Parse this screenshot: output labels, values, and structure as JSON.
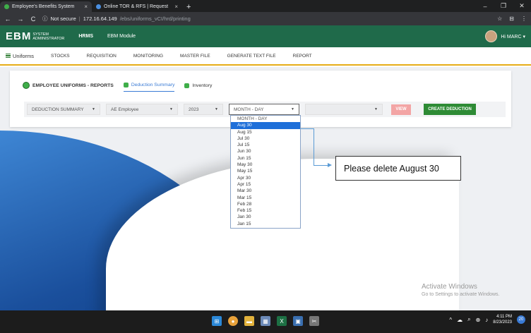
{
  "browser": {
    "tabs": [
      {
        "title": "Employee's Benefits System",
        "active": true,
        "close": "×"
      },
      {
        "title": "Online TOR & RFS | Request",
        "active": false,
        "close": "×"
      }
    ],
    "new_tab": "+",
    "window_controls": [
      "–",
      "❐",
      "✕"
    ],
    "nav": {
      "back": "←",
      "forward": "→",
      "reload": "C"
    },
    "security": "Not secure",
    "separator": "|",
    "url_host": "172.16.64.149",
    "url_path": "/ebs/uniforms_vCI/hrd/printing",
    "right_icons": [
      "☆",
      "⊟",
      "⋮"
    ]
  },
  "app": {
    "logo_big": "EBM",
    "logo_small_1": "SYSTEM",
    "logo_small_2": "ADMINISTRATOR",
    "header_links": [
      "HRMS",
      "EBM Module"
    ],
    "user_greeting": "Hi MARC ▾"
  },
  "nav": {
    "module": "Uniforms",
    "items": [
      "STOCKS",
      "REQUISITION",
      "MONITORING",
      "MASTER FILE",
      "GENERATE TEXT FILE",
      "REPORT"
    ]
  },
  "card": {
    "title": "EMPLOYEE UNIFORMS - REPORTS",
    "tabs": [
      "Deduction Summary",
      "Inventory"
    ],
    "filters": {
      "report_type": "DEDUCTION SUMMARY",
      "employee_type": "AE Employee",
      "year": "2023",
      "month_day": "MONTH - DAY",
      "extra": ""
    },
    "arrow": "▼",
    "view_label": "VIEW",
    "create_label": "CREATE DEDUCTION"
  },
  "dropdown": {
    "header": "MONTH - DAY",
    "selected": "Aug 30",
    "options": [
      "Aug 15",
      "Jul 30",
      "Jul 15",
      "Jun 30",
      "Jun 15",
      "May 30",
      "May 15",
      "Apr 30",
      "Apr 15",
      "Mar 30",
      "Mar 15",
      "Feb 28",
      "Feb 15",
      "Jan 30",
      "Jan 15"
    ]
  },
  "annotation": {
    "text": "Please delete August 30"
  },
  "watermark": {
    "line1": "Activate Windows",
    "line2": "Go to Settings to activate Windows."
  },
  "taskbar": {
    "time": "4:11 PM",
    "date": "8/23/2023",
    "notification_count": "20",
    "tray": [
      "^",
      "☁",
      "⌕",
      "⊕",
      "♪"
    ]
  },
  "colors": {
    "header_green": "#1f6a4a",
    "accent_yellow": "#e6ad17",
    "create_green": "#2e8b35",
    "view_pink": "#f3a5a5",
    "selected_blue": "#1e6fd9"
  }
}
